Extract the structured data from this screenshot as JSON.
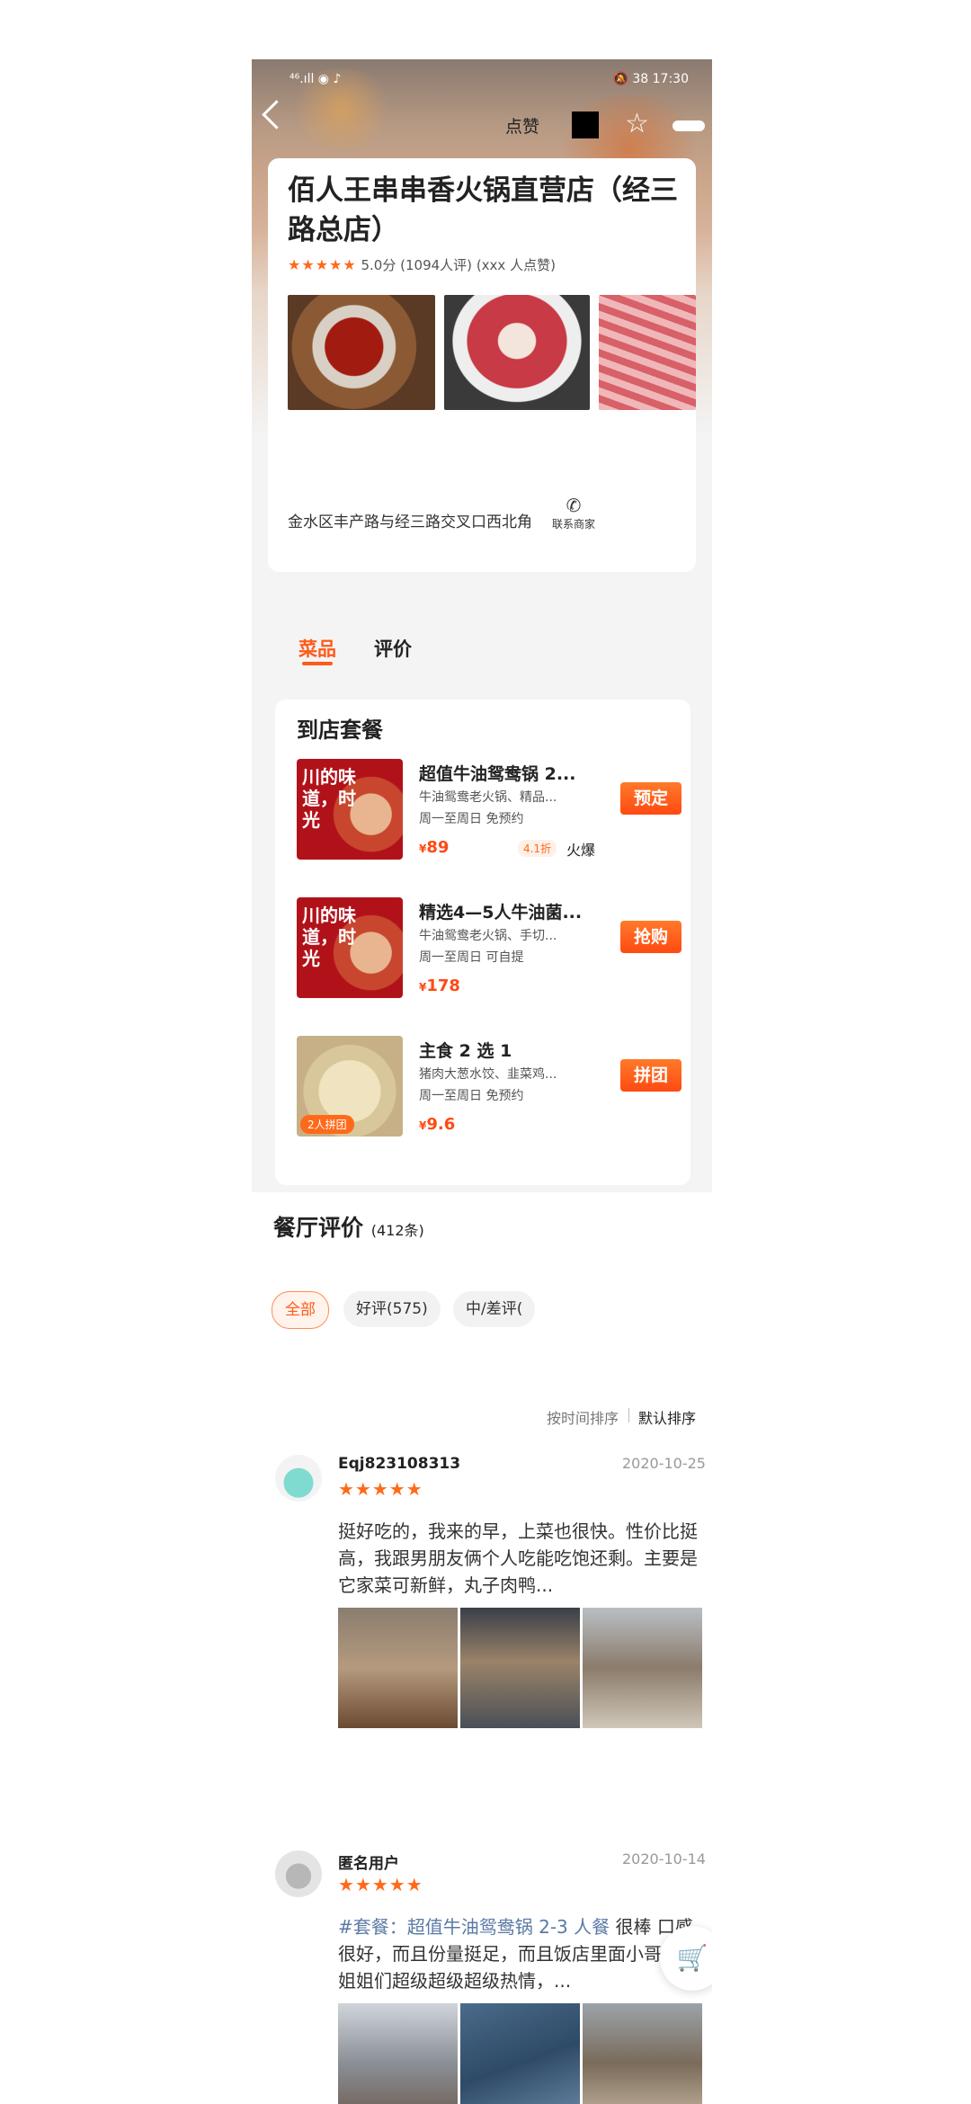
{
  "status_bar": {
    "left": "⁴⁶.ıll ◉ ♪",
    "right": "🔕 38 17:30"
  },
  "nav": {
    "like_label": "点赞"
  },
  "store": {
    "name": "佰人王串串香火锅直营店（经三路总店）",
    "stars": "★★★★★",
    "score": "5.0分",
    "review_count": "(1094人评)",
    "likes": "(xxx 人点赞)",
    "address": "金水区丰产路与经三路交叉口西北角",
    "contact": "联系商家"
  },
  "tabs": [
    {
      "label": "菜品"
    },
    {
      "label": "评价"
    }
  ],
  "packages": {
    "title": "到店套餐",
    "items": [
      {
        "title": "超值牛油鸳鸯锅 2...",
        "desc": "牛油鸳鸯老火锅、精品...",
        "days": "周一至周日  免预约",
        "price": "89",
        "discount": "4.1折",
        "hot": "火爆",
        "button": "预定",
        "thumb_text": "川的味道，时光"
      },
      {
        "title": "精选4—5人牛油菌...",
        "desc": "牛油鸳鸯老火锅、手切...",
        "days": "周一至周日  可自提",
        "price": "178",
        "button": "抢购",
        "thumb_text": "川的味道，时光"
      },
      {
        "title": "主食 2 选 1",
        "desc": "猪肉大葱水饺、韭菜鸡...",
        "days": "周一至周日  免预约",
        "price": "9.6",
        "button": "拼团",
        "badge": "2人拼团"
      }
    ]
  },
  "reviews_summary": {
    "title": "餐厅评价",
    "count": "(412条)",
    "chips": [
      {
        "label": "全部"
      },
      {
        "label": "好评(575)"
      },
      {
        "label": "中/差评("
      }
    ],
    "sort_time": "按时间排序",
    "sort_default": "默认排序"
  },
  "reviews": [
    {
      "user": "Eqj823108313",
      "date": "2020-10-25",
      "stars": "★★★★★",
      "text": "挺好吃的，我来的早，上菜也很快。性价比挺高，我跟男朋友俩个人吃能吃饱还剩。主要是它家菜可新鲜，丸子肉鸭..."
    },
    {
      "user": "匿名用户",
      "date": "2020-10-14",
      "stars": "★★★★★",
      "tag": "#套餐：超值牛油鸳鸯锅 2-3 人餐",
      "text": " 很棒 口感很好，而且份量挺足，而且饭店里面小哥哥小姐姐们超级超级超级热情，..."
    }
  ],
  "colors": {
    "accent": "#ff5a1a",
    "price": "#ff4a14",
    "star": "#ff6a1a"
  }
}
